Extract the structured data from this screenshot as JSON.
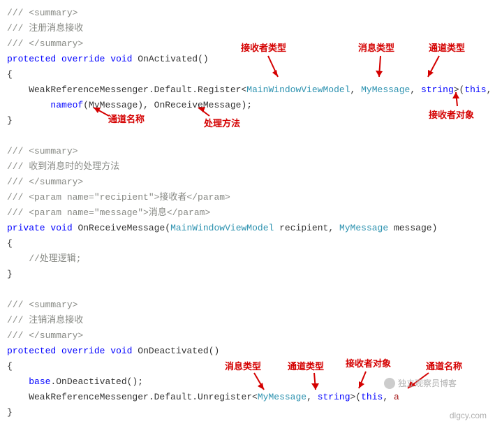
{
  "lines": [
    {
      "type": "comment",
      "text": "/// <summary>"
    },
    {
      "type": "comment",
      "text": "/// 注册消息接收"
    },
    {
      "type": "comment",
      "text": "/// </summary>"
    },
    {
      "type": "code",
      "tokens": [
        {
          "t": "kw",
          "v": "protected"
        },
        {
          "t": "plain",
          "v": " "
        },
        {
          "t": "kw",
          "v": "override"
        },
        {
          "t": "plain",
          "v": " "
        },
        {
          "t": "kw",
          "v": "void"
        },
        {
          "t": "plain",
          "v": " OnActivated()"
        }
      ]
    },
    {
      "type": "plain",
      "text": "{"
    },
    {
      "type": "code",
      "tokens": [
        {
          "t": "plain",
          "v": "    WeakReferenceMessenger.Default.Register<"
        },
        {
          "t": "type",
          "v": "MainWindowViewModel"
        },
        {
          "t": "plain",
          "v": ", "
        },
        {
          "t": "type",
          "v": "MyMessage"
        },
        {
          "t": "plain",
          "v": ", "
        },
        {
          "t": "kw",
          "v": "string"
        },
        {
          "t": "plain",
          "v": ">("
        },
        {
          "t": "kw",
          "v": "this"
        },
        {
          "t": "plain",
          "v": ","
        }
      ]
    },
    {
      "type": "code",
      "tokens": [
        {
          "t": "plain",
          "v": "        "
        },
        {
          "t": "kw",
          "v": "nameof"
        },
        {
          "t": "plain",
          "v": "(MyMessage), OnReceiveMessage);"
        }
      ]
    },
    {
      "type": "plain",
      "text": "}"
    },
    {
      "type": "blank",
      "text": ""
    },
    {
      "type": "comment",
      "text": "/// <summary>"
    },
    {
      "type": "comment",
      "text": "/// 收到消息时的处理方法"
    },
    {
      "type": "comment",
      "text": "/// </summary>"
    },
    {
      "type": "comment",
      "text": "/// <param name=\"recipient\">接收者</param>"
    },
    {
      "type": "comment",
      "text": "/// <param name=\"message\">消息</param>"
    },
    {
      "type": "code",
      "tokens": [
        {
          "t": "kw",
          "v": "private"
        },
        {
          "t": "plain",
          "v": " "
        },
        {
          "t": "kw",
          "v": "void"
        },
        {
          "t": "plain",
          "v": " OnReceiveMessage("
        },
        {
          "t": "type",
          "v": "MainWindowViewModel"
        },
        {
          "t": "plain",
          "v": " recipient, "
        },
        {
          "t": "type",
          "v": "MyMessage"
        },
        {
          "t": "plain",
          "v": " message)"
        }
      ]
    },
    {
      "type": "plain",
      "text": "{"
    },
    {
      "type": "comment",
      "text": "    //处理逻辑;"
    },
    {
      "type": "plain",
      "text": "}"
    },
    {
      "type": "blank",
      "text": ""
    },
    {
      "type": "comment",
      "text": "/// <summary>"
    },
    {
      "type": "comment",
      "text": "/// 注销消息接收"
    },
    {
      "type": "comment",
      "text": "/// </summary>"
    },
    {
      "type": "code",
      "tokens": [
        {
          "t": "kw",
          "v": "protected"
        },
        {
          "t": "plain",
          "v": " "
        },
        {
          "t": "kw",
          "v": "override"
        },
        {
          "t": "plain",
          "v": " "
        },
        {
          "t": "kw",
          "v": "void"
        },
        {
          "t": "plain",
          "v": " OnDeactivated()"
        }
      ]
    },
    {
      "type": "plain",
      "text": "{"
    },
    {
      "type": "code",
      "tokens": [
        {
          "t": "plain",
          "v": "    "
        },
        {
          "t": "kw",
          "v": "base"
        },
        {
          "t": "plain",
          "v": ".OnDeactivated();"
        }
      ]
    },
    {
      "type": "code",
      "tokens": [
        {
          "t": "plain",
          "v": "    WeakReferenceMessenger.Default.Unregister<"
        },
        {
          "t": "type",
          "v": "MyMessage"
        },
        {
          "t": "plain",
          "v": ", "
        },
        {
          "t": "kw",
          "v": "string"
        },
        {
          "t": "plain",
          "v": ">("
        },
        {
          "t": "kw",
          "v": "this"
        },
        {
          "t": "plain",
          "v": ", "
        },
        {
          "t": "str",
          "v": "a"
        }
      ]
    },
    {
      "type": "plain",
      "text": "}"
    }
  ],
  "annotations": {
    "recv_type": "接收者类型",
    "msg_type": "消息类型",
    "chan_type": "通道类型",
    "chan_name": "通道名称",
    "handler": "处理方法",
    "recv_obj": "接收者对象",
    "msg_type2": "消息类型",
    "chan_type2": "通道类型",
    "recv_obj2": "接收者对象",
    "chan_name2": "通道名称"
  },
  "footer": {
    "watermark": "独立观察员博客",
    "url": "dlgcy.com"
  }
}
